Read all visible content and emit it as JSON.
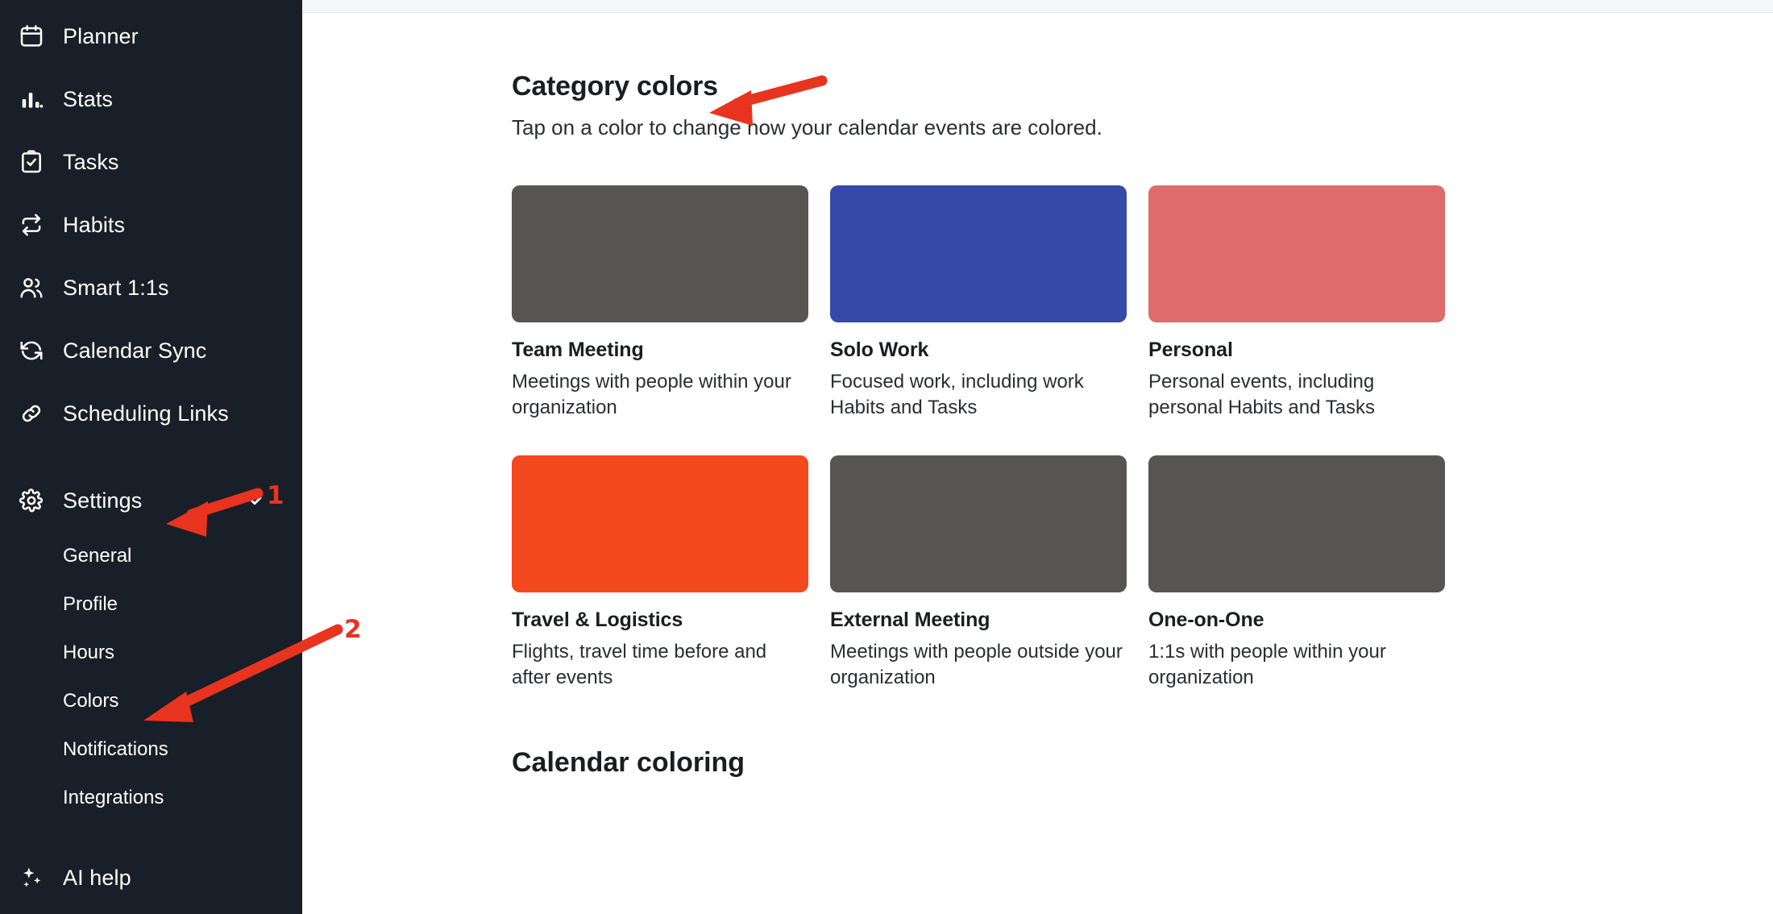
{
  "sidebar": {
    "items": [
      {
        "label": "Planner",
        "icon": "calendar-icon"
      },
      {
        "label": "Stats",
        "icon": "bar-chart-icon"
      },
      {
        "label": "Tasks",
        "icon": "clipboard-check-icon"
      },
      {
        "label": "Habits",
        "icon": "repeat-icon"
      },
      {
        "label": "Smart 1:1s",
        "icon": "people-icon"
      },
      {
        "label": "Calendar Sync",
        "icon": "sync-icon"
      },
      {
        "label": "Scheduling Links",
        "icon": "link-icon"
      }
    ],
    "settings": {
      "label": "Settings",
      "icon": "gear-icon",
      "chevron": "chevron-down-icon",
      "expanded": true,
      "subitems": [
        {
          "label": "General"
        },
        {
          "label": "Profile"
        },
        {
          "label": "Hours"
        },
        {
          "label": "Colors"
        },
        {
          "label": "Notifications"
        },
        {
          "label": "Integrations"
        }
      ]
    },
    "ai_help": {
      "label": "AI help",
      "icon": "sparkles-icon"
    },
    "background_color": "#181f28"
  },
  "main": {
    "section": {
      "title": "Category colors",
      "subtitle": "Tap on a color to change how your calendar events are colored."
    },
    "cards": [
      {
        "title": "Team Meeting",
        "description": "Meetings with people within your organization",
        "color": "#575553"
      },
      {
        "title": "Solo Work",
        "description": "Focused work, including work Habits and Tasks",
        "color": "#3449a8"
      },
      {
        "title": "Personal",
        "description": "Personal events, including personal Habits and Tasks",
        "color": "#e06b6b"
      },
      {
        "title": "Travel & Logistics",
        "description": "Flights, travel time before and after events",
        "color": "#f4491e"
      },
      {
        "title": "External Meeting",
        "description": "Meetings with people outside your organization",
        "color": "#575553"
      },
      {
        "title": "One-on-One",
        "description": "1:1s with people within your organization",
        "color": "#575553"
      }
    ],
    "next_section_title": "Calendar coloring"
  },
  "annotations": {
    "color": "#e8331f",
    "markers": [
      {
        "number": "1",
        "target": "Settings"
      },
      {
        "number": "2",
        "target": "Colors"
      }
    ]
  }
}
